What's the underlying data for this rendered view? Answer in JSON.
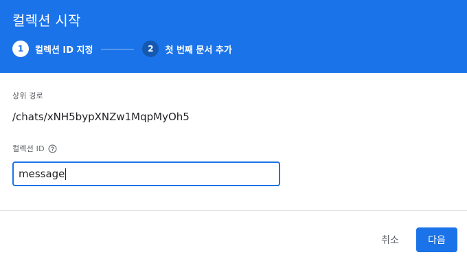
{
  "dialog": {
    "title": "컬렉션 시작",
    "steps": [
      {
        "number": "1",
        "label": "컬렉션 ID 지정",
        "state": "active"
      },
      {
        "number": "2",
        "label": "첫 번째 문서 추가",
        "state": "inactive"
      }
    ]
  },
  "form": {
    "parent_path_label": "상위 경로",
    "parent_path_value": "/chats/xNH5bypXNZw1MqpMyOh5",
    "collection_id_label": "컬렉션 ID",
    "collection_id_value": "message",
    "help_icon": "help-circle-icon"
  },
  "actions": {
    "cancel_label": "취소",
    "next_label": "다음"
  },
  "colors": {
    "primary": "#1a73e8",
    "header_text": "#ffffff",
    "muted_text": "#5f6368",
    "body_text": "#202124"
  }
}
